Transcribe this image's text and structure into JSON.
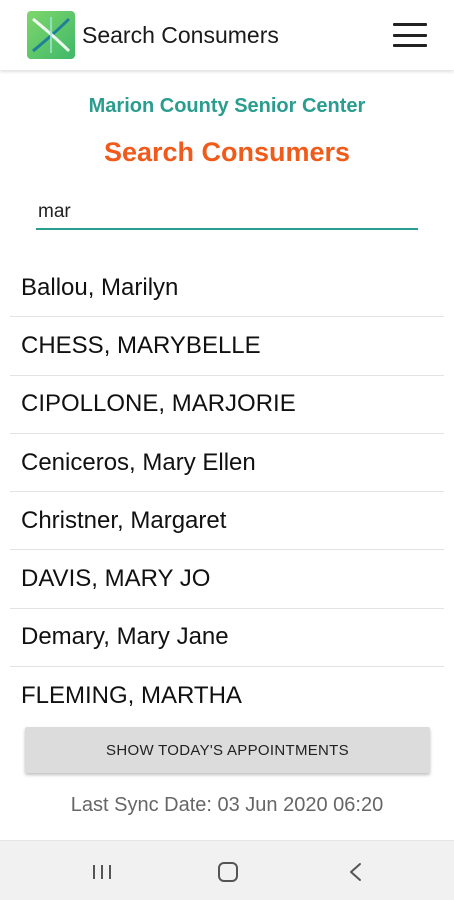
{
  "appbar": {
    "title": "Search Consumers",
    "logo_icon": "app-logo-icon",
    "menu_icon": "hamburger-menu-icon"
  },
  "header": {
    "center_name": "Marion County Senior Center",
    "page_title": "Search Consumers"
  },
  "search": {
    "value": "mar"
  },
  "results": [
    "Ballou, Marilyn",
    "CHESS, MARYBELLE",
    "CIPOLLONE, MARJORIE",
    "Ceniceros, Mary Ellen",
    "Christner, Margaret",
    "DAVIS, MARY JO",
    "Demary, Mary Jane",
    "FLEMING, MARTHA"
  ],
  "footer": {
    "appointments_button": "SHOW TODAY'S APPOINTMENTS",
    "last_sync": "Last Sync Date: 03 Jun 2020 06:20"
  },
  "navbar": {
    "recent_icon": "recent-apps-icon",
    "home_icon": "home-icon",
    "back_icon": "back-icon"
  },
  "colors": {
    "accent": "#2a9d8f",
    "title": "#f05a1a",
    "button_bg": "#dcdcdc"
  }
}
